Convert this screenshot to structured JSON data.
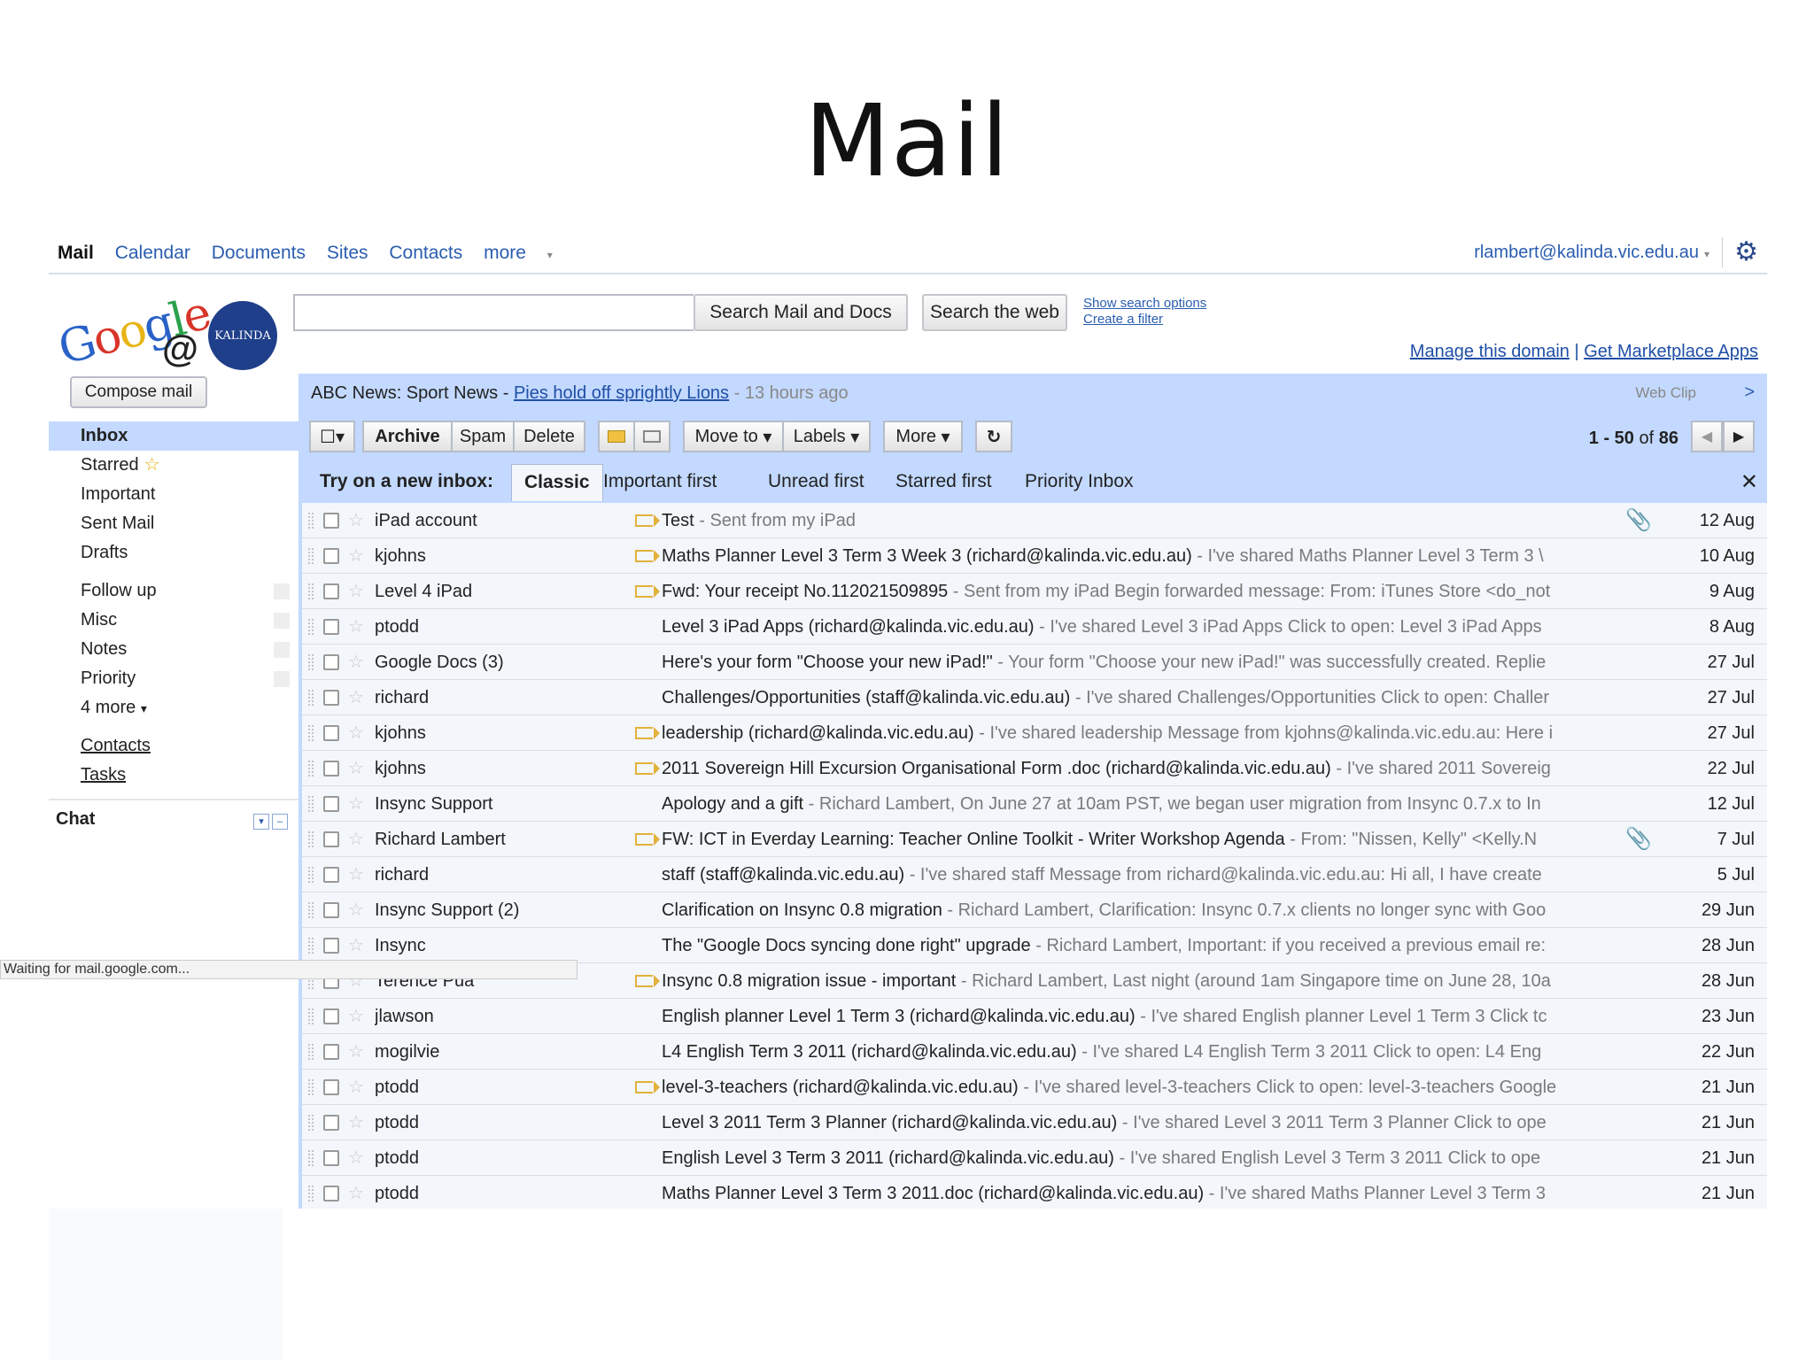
{
  "slide_title": "Mail",
  "topnav": {
    "links": [
      "Mail",
      "Calendar",
      "Documents",
      "Sites",
      "Contacts",
      "more"
    ],
    "account": "rlambert@kalinda.vic.edu.au"
  },
  "logo": {
    "org": "KALINDA"
  },
  "search": {
    "value": "",
    "search_mail_label": "Search Mail and Docs",
    "search_web_label": "Search the web",
    "show_options": "Show search options",
    "create_filter": "Create a filter"
  },
  "domain_links": {
    "manage": "Manage this domain",
    "sep": "|",
    "marketplace": "Get Marketplace Apps"
  },
  "sidebar": {
    "compose": "Compose mail",
    "items": [
      "Inbox",
      "Starred",
      "Important",
      "Sent Mail",
      "Drafts"
    ],
    "labels": [
      "Follow up",
      "Misc",
      "Notes",
      "Priority",
      "4 more"
    ],
    "links": [
      "Contacts",
      "Tasks"
    ],
    "chat": "Chat"
  },
  "webclip": {
    "source": "ABC News: Sport News -",
    "headline": "Pies hold off sprightly Lions",
    "time": "- 13 hours ago",
    "tag": "Web Clip",
    "next": ">"
  },
  "toolbar": {
    "archive": "Archive",
    "spam": "Spam",
    "delete": "Delete",
    "move_to": "Move to",
    "labels": "Labels",
    "more": "More",
    "pager_range": "1 - 50",
    "pager_of": "of",
    "pager_total": "86"
  },
  "inbox_tabs": {
    "prompt": "Try on a new inbox:",
    "tabs": [
      "Classic",
      "Important first",
      "Unread first",
      "Starred first",
      "Priority Inbox"
    ],
    "selected": "Classic"
  },
  "messages": [
    {
      "sender": "iPad account",
      "important": true,
      "subject": "Test",
      "snippet": " - Sent from my iPad",
      "attachment": true,
      "date": "12 Aug"
    },
    {
      "sender": "kjohns",
      "important": true,
      "subject": "Maths Planner Level 3 Term 3 Week 3 (richard@kalinda.vic.edu.au)",
      "snippet": " - I've shared Maths Planner Level 3 Term 3 \\",
      "attachment": false,
      "date": "10 Aug"
    },
    {
      "sender": "Level 4 iPad",
      "important": true,
      "subject": "Fwd: Your receipt No.112021509895",
      "snippet": " - Sent from my iPad Begin forwarded message: From: iTunes Store <do_not",
      "attachment": false,
      "date": "9 Aug"
    },
    {
      "sender": "ptodd",
      "important": false,
      "subject": "Level 3 iPad Apps (richard@kalinda.vic.edu.au)",
      "snippet": " - I've shared Level 3 iPad Apps Click to open: Level 3 iPad Apps",
      "attachment": false,
      "date": "8 Aug"
    },
    {
      "sender": "Google Docs (3)",
      "important": false,
      "subject": "Here's your form \"Choose your new iPad!\"",
      "snippet": " - Your form \"Choose your new iPad!\" was successfully created. Replie",
      "attachment": false,
      "date": "27 Jul"
    },
    {
      "sender": "richard",
      "important": false,
      "subject": "Challenges/Opportunities (staff@kalinda.vic.edu.au)",
      "snippet": " - I've shared Challenges/Opportunities Click to open: Challer",
      "attachment": false,
      "date": "27 Jul"
    },
    {
      "sender": "kjohns",
      "important": true,
      "subject": "leadership (richard@kalinda.vic.edu.au)",
      "snippet": " - I've shared leadership Message from kjohns@kalinda.vic.edu.au: Here i",
      "attachment": false,
      "date": "27 Jul"
    },
    {
      "sender": "kjohns",
      "important": true,
      "subject": "2011 Sovereign Hill Excursion Organisational Form .doc (richard@kalinda.vic.edu.au)",
      "snippet": " - I've shared 2011 Sovereig",
      "attachment": false,
      "date": "22 Jul"
    },
    {
      "sender": "Insync Support",
      "important": false,
      "subject": "Apology and a gift",
      "snippet": " - Richard Lambert, On June 27 at 10am PST, we began user migration from Insync 0.7.x to In",
      "attachment": false,
      "date": "12 Jul"
    },
    {
      "sender": "Richard Lambert",
      "important": true,
      "subject": "FW: ICT in Everday Learning: Teacher Online Toolkit - Writer Workshop Agenda",
      "snippet": " - From: \"Nissen, Kelly\" <Kelly.N",
      "attachment": true,
      "date": "7 Jul"
    },
    {
      "sender": "richard",
      "important": false,
      "subject": "staff (staff@kalinda.vic.edu.au)",
      "snippet": " - I've shared staff Message from richard@kalinda.vic.edu.au: Hi all, I have create",
      "attachment": false,
      "date": "5 Jul"
    },
    {
      "sender": "Insync Support (2)",
      "important": false,
      "subject": "Clarification on Insync 0.8 migration",
      "snippet": " - Richard Lambert, Clarification: Insync 0.7.x clients no longer sync with Goo",
      "attachment": false,
      "date": "29 Jun"
    },
    {
      "sender": "Insync",
      "important": false,
      "subject": "The \"Google Docs syncing done right\" upgrade",
      "snippet": " - Richard Lambert, Important: if you received a previous email re:",
      "attachment": false,
      "date": "28 Jun"
    },
    {
      "sender": "Terence Pua",
      "important": true,
      "subject": "Insync 0.8 migration issue - important",
      "snippet": " - Richard Lambert, Last night (around 1am Singapore time on June 28, 10a",
      "attachment": false,
      "date": "28 Jun"
    },
    {
      "sender": "jlawson",
      "important": false,
      "subject": "English planner Level 1 Term 3 (richard@kalinda.vic.edu.au)",
      "snippet": " - I've shared English planner Level 1 Term 3 Click tc",
      "attachment": false,
      "date": "23 Jun"
    },
    {
      "sender": "mogilvie",
      "important": false,
      "subject": "L4 English Term 3 2011 (richard@kalinda.vic.edu.au)",
      "snippet": " - I've shared L4 English Term 3 2011 Click to open: L4 Eng",
      "attachment": false,
      "date": "22 Jun"
    },
    {
      "sender": "ptodd",
      "important": true,
      "subject": "level-3-teachers (richard@kalinda.vic.edu.au)",
      "snippet": " - I've shared level-3-teachers Click to open: level-3-teachers Google",
      "attachment": false,
      "date": "21 Jun"
    },
    {
      "sender": "ptodd",
      "important": false,
      "subject": "Level 3 2011 Term 3 Planner (richard@kalinda.vic.edu.au)",
      "snippet": " - I've shared Level 3 2011 Term 3 Planner Click to ope",
      "attachment": false,
      "date": "21 Jun"
    },
    {
      "sender": "ptodd",
      "important": false,
      "subject": "English Level 3 Term 3 2011 (richard@kalinda.vic.edu.au)",
      "snippet": " - I've shared English Level 3 Term 3 2011 Click to ope",
      "attachment": false,
      "date": "21 Jun"
    },
    {
      "sender": "ptodd",
      "important": false,
      "subject": "Maths Planner Level 3 Term 3 2011.doc (richard@kalinda.vic.edu.au)",
      "snippet": " - I've shared Maths Planner Level 3 Term 3",
      "attachment": false,
      "date": "21 Jun"
    }
  ],
  "status_bar": "Waiting for mail.google.com..."
}
